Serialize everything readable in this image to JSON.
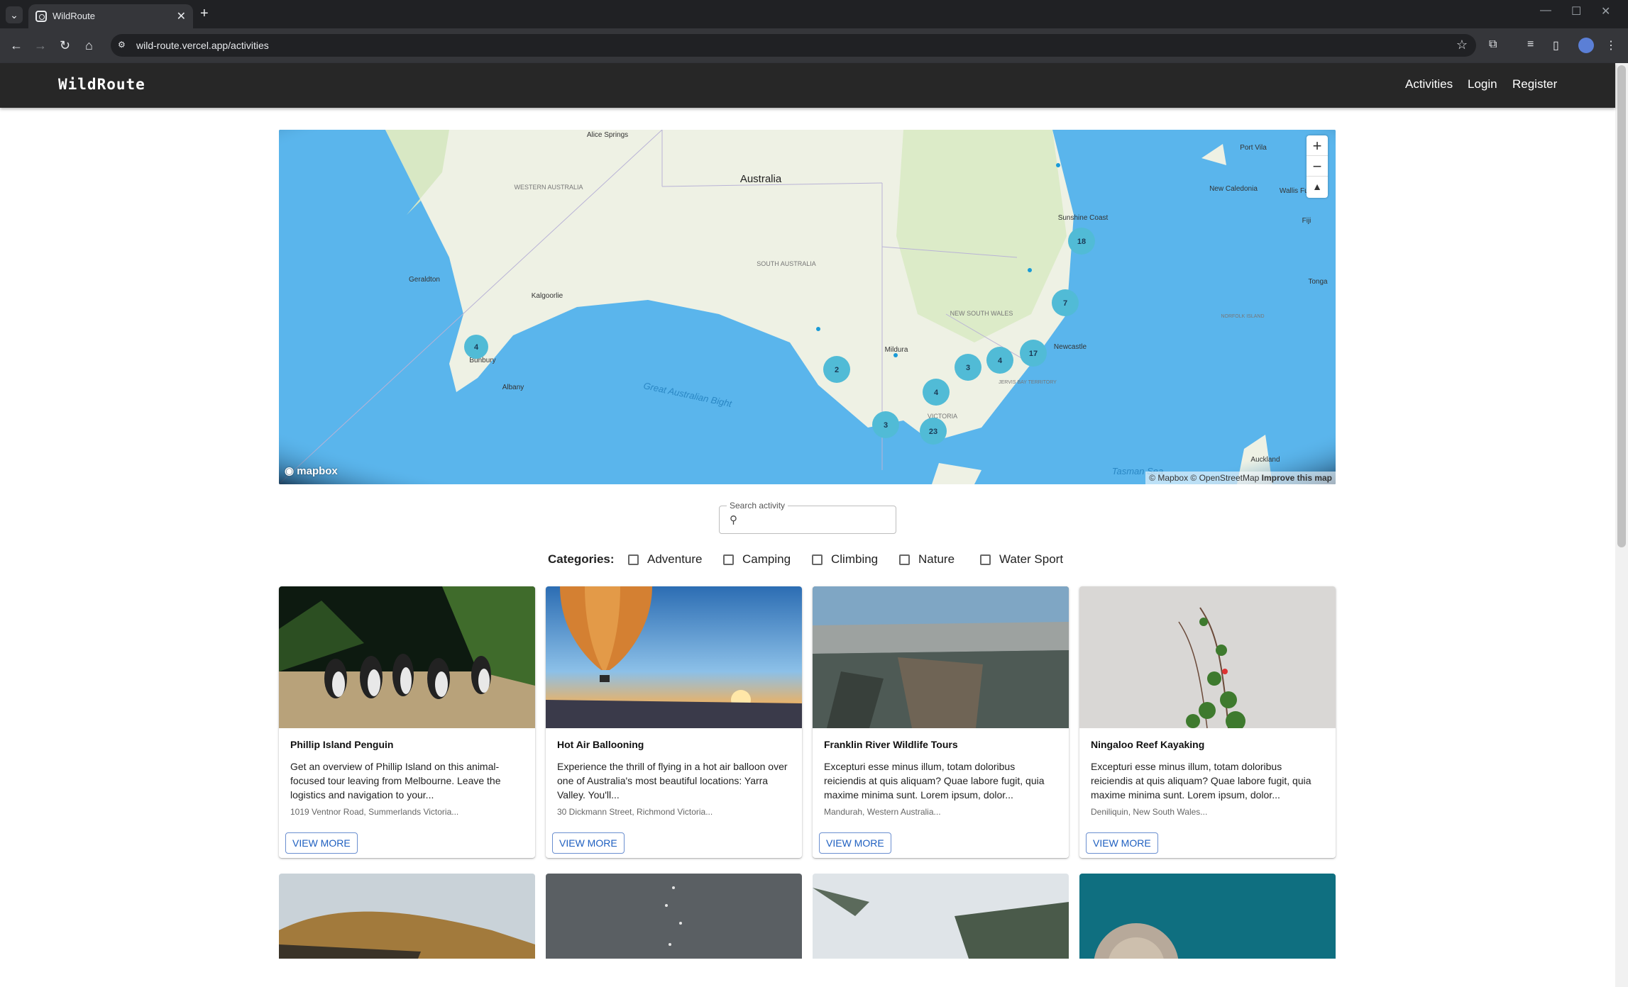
{
  "browser": {
    "tab_title": "WildRoute",
    "url": "wild-route.vercel.app/activities"
  },
  "app": {
    "brand": "WildRoute",
    "nav": [
      "Activities",
      "Login",
      "Register"
    ]
  },
  "map": {
    "country_label": "Australia",
    "place_labels": [
      "Alice Springs",
      "WESTERN AUSTRALIA",
      "SOUTH AUSTRALIA",
      "NEW SOUTH WALES",
      "VICTORIA",
      "JERVIS BAY TERRITORY",
      "Geraldton",
      "Kalgoorlie",
      "Bunbury",
      "Albany",
      "Mildura",
      "Newcastle",
      "Sunshine Coast",
      "Port Vila",
      "New Caledonia",
      "Wallis Futuna",
      "Fiji",
      "Tonga",
      "NORFOLK ISLAND",
      "Auckland",
      "Great Australian Bight",
      "Tasman Sea"
    ],
    "clusters": [
      "4",
      "2",
      "3",
      "23",
      "4",
      "3",
      "4",
      "17",
      "7",
      "18"
    ],
    "zoom_in": "+",
    "zoom_out": "−",
    "compass": "▲",
    "logo": "mapbox",
    "attribution": "© Mapbox © OpenStreetMap",
    "improve": "Improve this map"
  },
  "search": {
    "label": "Search activity",
    "value": ""
  },
  "categories": {
    "heading": "Categories:",
    "items": [
      "Adventure",
      "Camping",
      "Climbing",
      "Nature",
      "Water Sport"
    ]
  },
  "activities": [
    {
      "name": "Phillip Island Penguin",
      "desc": "Get an overview of Phillip Island on this animal-focused tour leaving from Melbourne. Leave the logistics and navigation to your...",
      "addr": "1019 Ventnor Road, Summerlands Victoria...",
      "button": "VIEW MORE"
    },
    {
      "name": "Hot Air Ballooning",
      "desc": "Experience the thrill of flying in a hot air balloon over one of Australia's most beautiful locations: Yarra Valley. You'll...",
      "addr": "30 Dickmann Street, Richmond Victoria...",
      "button": "VIEW MORE"
    },
    {
      "name": "Franklin River Wildlife Tours",
      "desc": "Excepturi esse minus illum, totam doloribus reiciendis at quis aliquam? Quae labore fugit, quia maxime minima sunt. Lorem ipsum, dolor...",
      "addr": "Mandurah, Western Australia...",
      "button": "VIEW MORE"
    },
    {
      "name": "Ningaloo Reef Kayaking",
      "desc": "Excepturi esse minus illum, totam doloribus reiciendis at quis aliquam? Quae labore fugit, quia maxime minima sunt. Lorem ipsum, dolor...",
      "addr": "Deniliquin, New South Wales...",
      "button": "VIEW MORE"
    }
  ],
  "colors": {
    "appbar": "#272727",
    "cluster": "#51bbd6",
    "ocean": "#5ab5ec",
    "land": "#eef1e4",
    "button": "#1e5fc0"
  }
}
